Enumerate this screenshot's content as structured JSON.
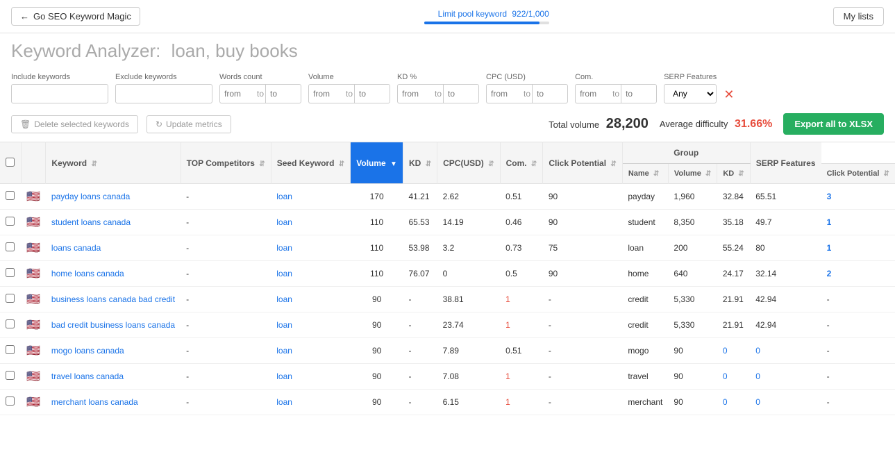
{
  "nav": {
    "back_label": "Go SEO Keyword Magic",
    "my_lists_label": "My lists"
  },
  "limit_pool": {
    "label": "Limit pool keyword",
    "value": "922/1,000",
    "percent": 92.2
  },
  "header": {
    "title_prefix": "Keyword Analyzer:",
    "title_keywords": "loan, buy books"
  },
  "filters": {
    "include_label": "Include keywords",
    "include_placeholder": "",
    "exclude_label": "Exclude keywords",
    "exclude_placeholder": "",
    "words_count_label": "Words count",
    "volume_label": "Volume",
    "kd_label": "KD %",
    "cpc_label": "CPC (USD)",
    "com_label": "Com.",
    "serp_label": "SERP Features",
    "from_placeholder": "from",
    "to_placeholder": "to",
    "serp_options": [
      "Any"
    ],
    "serp_default": "Any"
  },
  "stats": {
    "delete_label": "Delete selected keywords",
    "update_label": "Update metrics",
    "total_volume_label": "Total volume",
    "total_volume": "28,200",
    "avg_difficulty_label": "Average difficulty",
    "avg_difficulty": "31.66%",
    "export_label": "Export all to XLSX"
  },
  "table": {
    "group_label": "Group",
    "columns": {
      "keyword": "Keyword",
      "top_competitors": "TOP Competitors",
      "seed_keyword": "Seed Keyword",
      "volume": "Volume",
      "kd": "KD",
      "cpc_usd": "CPC(USD)",
      "com": "Com.",
      "click_potential": "Click Potential",
      "group_name": "Name",
      "group_volume": "Volume",
      "group_kd": "KD",
      "group_click_potential": "Click Potential",
      "serp_features": "SERP Features"
    },
    "rows": [
      {
        "keyword": "payday loans canada",
        "top_competitors": "-",
        "seed": "loan",
        "volume": "170",
        "kd": "41.21",
        "cpc": "2.62",
        "com": "0.51",
        "click_potential": "90",
        "group_name": "payday",
        "group_volume": "1,960",
        "group_kd": "32.84",
        "group_click": "65.51",
        "serp": "3",
        "serp_type": "blue"
      },
      {
        "keyword": "student loans canada",
        "top_competitors": "-",
        "seed": "loan",
        "volume": "110",
        "kd": "65.53",
        "cpc": "14.19",
        "com": "0.46",
        "click_potential": "90",
        "group_name": "student",
        "group_volume": "8,350",
        "group_kd": "35.18",
        "group_click": "49.7",
        "serp": "1",
        "serp_type": "blue"
      },
      {
        "keyword": "loans canada",
        "top_competitors": "-",
        "seed": "loan",
        "volume": "110",
        "kd": "53.98",
        "cpc": "3.2",
        "com": "0.73",
        "click_potential": "75",
        "group_name": "loan",
        "group_volume": "200",
        "group_kd": "55.24",
        "group_click": "80",
        "serp": "1",
        "serp_type": "blue"
      },
      {
        "keyword": "home loans canada",
        "top_competitors": "-",
        "seed": "loan",
        "volume": "110",
        "kd": "76.07",
        "cpc": "0",
        "com": "0.5",
        "click_potential": "90",
        "group_name": "home",
        "group_volume": "640",
        "group_kd": "24.17",
        "group_click": "32.14",
        "serp": "2",
        "serp_type": "blue"
      },
      {
        "keyword": "business loans canada bad credit",
        "top_competitors": "-",
        "seed": "loan",
        "volume": "90",
        "kd": "-",
        "cpc": "38.81",
        "com": "1",
        "com_type": "red",
        "click_potential": "-",
        "group_name": "credit",
        "group_volume": "5,330",
        "group_kd": "21.91",
        "group_click": "42.94",
        "serp": "-",
        "serp_type": "none"
      },
      {
        "keyword": "bad credit business loans canada",
        "top_competitors": "-",
        "seed": "loan",
        "volume": "90",
        "kd": "-",
        "cpc": "23.74",
        "com": "1",
        "com_type": "red",
        "click_potential": "-",
        "group_name": "credit",
        "group_volume": "5,330",
        "group_kd": "21.91",
        "group_click": "42.94",
        "serp": "-",
        "serp_type": "none"
      },
      {
        "keyword": "mogo loans canada",
        "top_competitors": "-",
        "seed": "loan",
        "volume": "90",
        "kd": "-",
        "cpc": "7.89",
        "com": "0.51",
        "click_potential": "-",
        "group_name": "mogo",
        "group_volume": "90",
        "group_kd": "0",
        "group_kd_type": "zero",
        "group_click": "0",
        "group_click_type": "zero",
        "serp": "-",
        "serp_type": "none"
      },
      {
        "keyword": "travel loans canada",
        "top_competitors": "-",
        "seed": "loan",
        "volume": "90",
        "kd": "-",
        "cpc": "7.08",
        "com": "1",
        "com_type": "red",
        "click_potential": "-",
        "group_name": "travel",
        "group_volume": "90",
        "group_kd": "0",
        "group_kd_type": "zero",
        "group_click": "0",
        "group_click_type": "zero",
        "serp": "-",
        "serp_type": "none"
      },
      {
        "keyword": "merchant loans canada",
        "top_competitors": "-",
        "seed": "loan",
        "volume": "90",
        "kd": "-",
        "cpc": "6.15",
        "com": "1",
        "com_type": "red",
        "click_potential": "-",
        "group_name": "merchant",
        "group_volume": "90",
        "group_kd": "0",
        "group_kd_type": "zero",
        "group_click": "0",
        "group_click_type": "zero",
        "serp": "-",
        "serp_type": "none"
      }
    ]
  }
}
